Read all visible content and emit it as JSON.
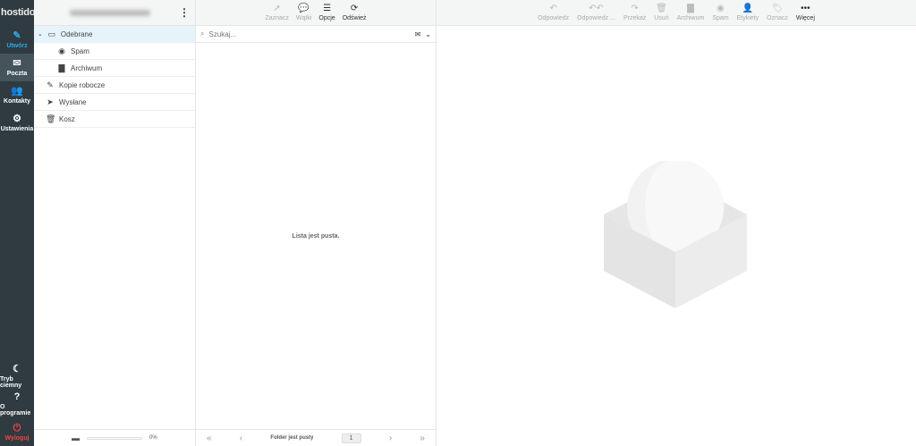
{
  "logo": "hostido",
  "sidebar": {
    "items": [
      {
        "label": "Utwórz",
        "icon": "compose-icon"
      },
      {
        "label": "Poczta",
        "icon": "mail-icon"
      },
      {
        "label": "Kontakty",
        "icon": "contacts-icon"
      },
      {
        "label": "Ustawienia",
        "icon": "gear-icon"
      }
    ],
    "bottom": [
      {
        "label": "Tryb ciemny",
        "icon": "moon-icon"
      },
      {
        "label": "O programie",
        "icon": "help-icon"
      },
      {
        "label": "Wyloguj",
        "icon": "power-icon"
      }
    ]
  },
  "folders": [
    {
      "label": "Odebrane",
      "icon": "inbox-icon"
    },
    {
      "label": "Spam",
      "icon": "spam-icon"
    },
    {
      "label": "Archiwum",
      "icon": "archive-icon"
    },
    {
      "label": "Kopie robocze",
      "icon": "pencil-icon"
    },
    {
      "label": "Wysłane",
      "icon": "send-icon"
    },
    {
      "label": "Kosz",
      "icon": "trash-icon"
    }
  ],
  "quota": "0%",
  "quota_fraction": 0,
  "list_toolbar": [
    "Zaznacz",
    "Wątki",
    "Opcje",
    "Odśwież"
  ],
  "search": {
    "placeholder": "Szukaj..."
  },
  "list_empty": "Lista jest pusta.",
  "list_footer": {
    "status": "Folder jest pusty",
    "page": "1"
  },
  "mail_toolbar": [
    "Odpowiedz",
    "Odpowiedz ...",
    "Przekaż",
    "Usuń",
    "Archiwum",
    "Spam",
    "Etykiety",
    "Oznacz",
    "Więcej"
  ],
  "colors": {
    "sidebar": "#2f3b40",
    "accent": "#2fa4e7",
    "logout": "#e44444"
  }
}
